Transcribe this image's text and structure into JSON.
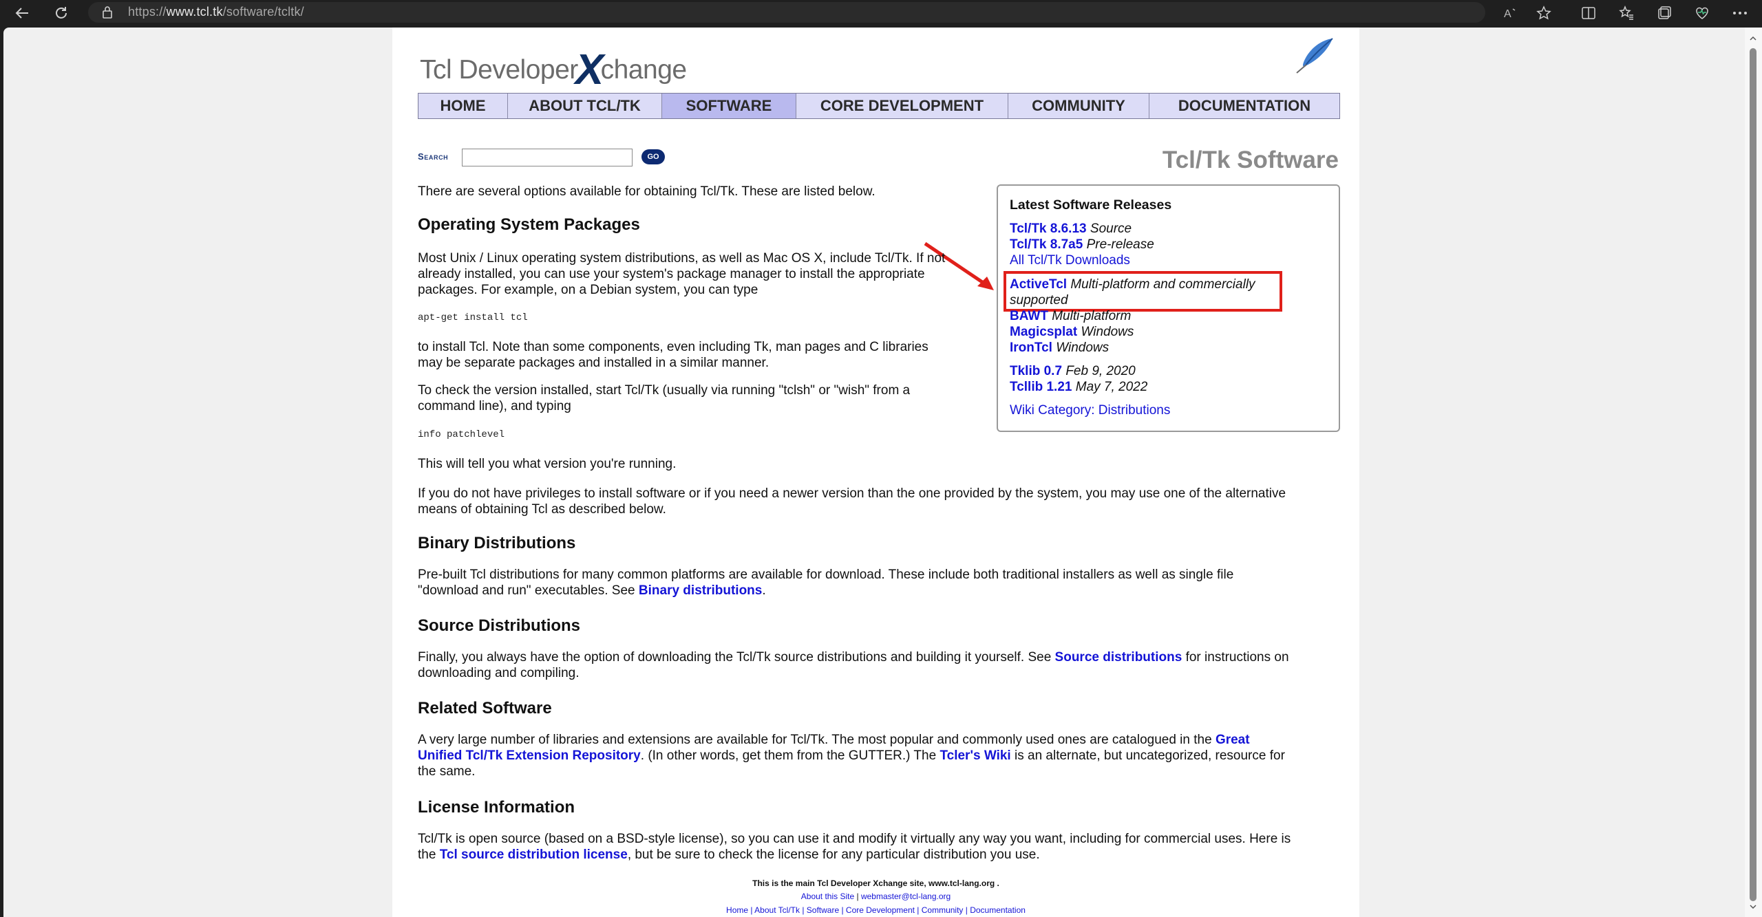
{
  "browser": {
    "url_prefix": "https://",
    "url_host": "www.tcl.tk",
    "url_path": "/software/tcltk/"
  },
  "site": {
    "logo_part1": "Tcl Developer",
    "logo_x": "X",
    "logo_part2": "change"
  },
  "menu": [
    {
      "label": "HOME",
      "active": false
    },
    {
      "label": "ABOUT TCL/TK",
      "active": false
    },
    {
      "label": "SOFTWARE",
      "active": true
    },
    {
      "label": "CORE DEVELOPMENT",
      "active": false
    },
    {
      "label": "COMMUNITY",
      "active": false
    },
    {
      "label": "DOCUMENTATION",
      "active": false
    }
  ],
  "search": {
    "label": "Search",
    "go": "GO"
  },
  "page_title": "Tcl/Tk Software",
  "sidebox": {
    "header": "Latest Software Releases",
    "r1_link": "Tcl/Tk 8.6.13",
    "r1_note": "Source",
    "r2_link": "Tcl/Tk 8.7a5",
    "r2_note": "Pre-release",
    "r3_link": "All Tcl/Tk Downloads",
    "r4_link": "ActiveTcl",
    "r4_note_a": "Multi-platform and commercially",
    "r4_note_b": "supported",
    "r5_link": "BAWT",
    "r5_note": "Multi-platform",
    "r6_link": "Magicsplat",
    "r6_note": "Windows",
    "r7_link": "IronTcl",
    "r7_note": "Windows",
    "r8_link": "Tklib 0.7",
    "r8_note": "Feb 9, 2020",
    "r9_link": "Tcllib 1.21",
    "r9_note": "May 7, 2022",
    "r10_link": "Wiki Category: Distributions"
  },
  "intro": "There are several options available for obtaining Tcl/Tk. These are listed below.",
  "sec_os": {
    "title": "Operating System Packages",
    "p1_l1": "Most Unix / Linux operating system distributions, as well as Mac OS X, include Tcl/Tk. If not",
    "p1_l2": "already installed, you can use your system's package manager to install the appropriate",
    "p1_l3": "packages. For example, on a Debian system, you can type",
    "code1": "apt-get install tcl",
    "p2_l1": "to install Tcl. Note than some components, even including Tk, man pages and C libraries",
    "p2_l2": "may be separate packages and installed in a similar manner.",
    "p3_l1": "To check the version installed, start Tcl/Tk (usually via running \"tclsh\" or \"wish\" from a",
    "p3_l2": "command line), and typing",
    "code2": "info patchlevel",
    "p4": "This will tell you what version you're running.",
    "p5_l1": "If you do not have privileges to install software or if you need a newer version than the one provided by the system, you may use one of the alternative",
    "p5_l2": "means of obtaining Tcl as described below."
  },
  "sec_bin": {
    "title": "Binary Distributions",
    "l1": "Pre-built Tcl distributions for many common platforms are available for download. These include both traditional installers as well as single file",
    "l2a": "\"download and run\" executables. See ",
    "l2link": "Binary distributions",
    "l2b": "."
  },
  "sec_src": {
    "title": "Source Distributions",
    "l1a": "Finally, you always have the option of downloading the Tcl/Tk source distributions and building it yourself. See ",
    "l1link": "Source distributions",
    "l1b": " for instructions on",
    "l2": "downloading and compiling."
  },
  "sec_rel": {
    "title": "Related Software",
    "l1a": "A very large number of libraries and extensions are available for Tcl/Tk. The most popular and commonly used ones are catalogued in the ",
    "l1link": "Great",
    "l2link": "Unified Tcl/Tk Extension Repository",
    "l2a": ". (In other words, get them from the GUTTER.) The ",
    "l2link2": "Tcler's Wiki",
    "l2b": " is an alternate, but uncategorized, resource for",
    "l3": "the same."
  },
  "sec_lic": {
    "title": "License Information",
    "l1": "Tcl/Tk is open source (based on a BSD-style license), so you can use it and modify it virtually any way you want, including for commercial uses. Here is",
    "l2a": "the ",
    "l2link": "Tcl source distribution license",
    "l2b": ", but be sure to check the license for any particular distribution you use."
  },
  "footer": {
    "main": "This is the main Tcl Developer Xchange site, www.tcl-lang.org .",
    "about": "About this Site",
    "sep": " | ",
    "email": "webmaster@tcl-lang.org",
    "nav": "Home | About Tcl/Tk | Software | Core Development | Community | Documentation"
  },
  "colors": {
    "link": "#1414d6",
    "highlight": "#e0201a",
    "menu_bg": "#dcdcf7",
    "menu_active": "#b9b9ee"
  }
}
